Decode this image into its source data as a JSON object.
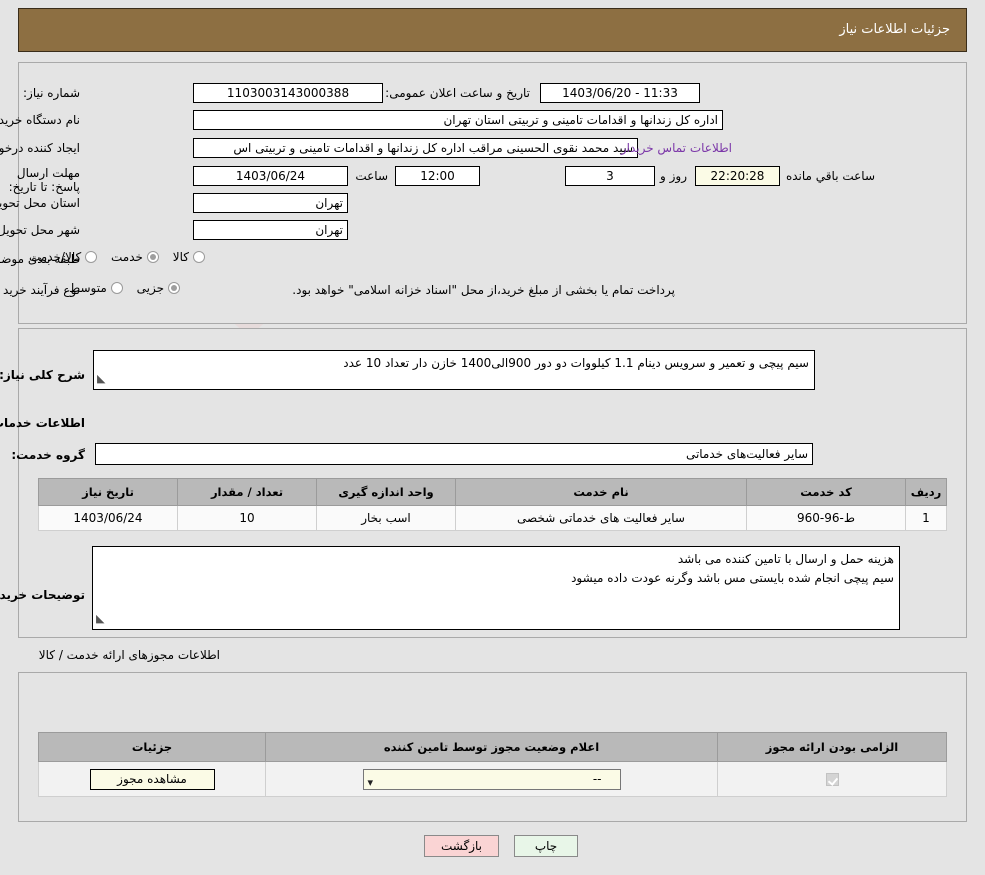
{
  "header": {
    "title": "جزئیات اطلاعات نیاز"
  },
  "watermark": {
    "text": "AnaTender.net"
  },
  "form": {
    "need_number": {
      "label": "شماره نیاز:",
      "value": "1103003143000388"
    },
    "announce_datetime": {
      "label": "تاریخ و ساعت اعلان عمومی:",
      "value": "11:33 - 1403/06/20"
    },
    "buyer_org": {
      "label": "نام دستگاه خریدار:",
      "value": "اداره کل زندانها و اقدامات تامینی و تربیتی استان تهران"
    },
    "requester": {
      "label": "ایجاد کننده درخواست:",
      "value": "سید محمد نقوی الحسینی مراقب  اداره کل زندانها و اقدامات تامینی و تربیتی اس",
      "contact_link": "اطلاعات تماس خریدار"
    },
    "deadline": {
      "label": "مهلت ارسال پاسخ: تا تاریخ:",
      "date": "1403/06/24",
      "hour_label": "ساعت",
      "hour": "12:00",
      "days": "3",
      "days_label": "روز و",
      "countdown": "22:20:28",
      "countdown_label": "ساعت باقي مانده"
    },
    "delivery_province": {
      "label": "استان محل تحویل:",
      "value": "تهران"
    },
    "delivery_city": {
      "label": "شهر محل تحویل:",
      "value": "تهران"
    },
    "subject_category": {
      "label": "طبقه بندی موضوعی:",
      "options": [
        {
          "label": "کالا",
          "selected": false
        },
        {
          "label": "خدمت",
          "selected": true
        },
        {
          "label": "کالا/خدمت",
          "selected": false
        }
      ]
    },
    "purchase_type": {
      "label": "نوع فرآیند خرید :",
      "options": [
        {
          "label": "جزیی",
          "selected": true
        },
        {
          "label": "متوسط",
          "selected": false
        }
      ],
      "note": "پرداخت تمام یا بخشی از مبلغ خرید،از محل \"اسناد خزانه اسلامی\" خواهد بود."
    }
  },
  "need_description": {
    "label": "شرح کلی نیاز:",
    "value": "سیم پیچی و تعمیر و سرویس دینام 1.1 کیلووات دو دور 900الی1400 خازن دار تعداد 10 عدد"
  },
  "services_section": {
    "title": "اطلاعات خدمات مورد نیاز",
    "service_group": {
      "label": "گروه خدمت:",
      "value": "سایر فعالیت‌های خدماتی"
    },
    "table": {
      "headers": [
        "ردیف",
        "کد خدمت",
        "نام خدمت",
        "واحد اندازه گیری",
        "تعداد / مقدار",
        "تاریخ نیاز"
      ],
      "rows": [
        {
          "row": "1",
          "code": "ط-96-960",
          "name": "سایر فعالیت های خدماتی شخصی",
          "unit": "اسب بخار",
          "qty": "10",
          "need_date": "1403/06/24"
        }
      ]
    }
  },
  "buyer_notes": {
    "label": "توضیحات خریدار:",
    "line1": "هزینه حمل و ارسال با تامین کننده می باشد",
    "line2": "سیم پیچی انجام شده بایستی مس باشد وگرنه عودت داده میشود"
  },
  "permits": {
    "section_title": "اطلاعات مجوزهای ارائه خدمت / کالا",
    "headers": [
      "الزامی بودن ارائه مجوز",
      "اعلام وضعیت مجوز توسط تامین کننده",
      "جزئیات"
    ],
    "rows": [
      {
        "required": true,
        "status_value": "--",
        "details_button": "مشاهده مجوز"
      }
    ]
  },
  "footer": {
    "print_label": "چاپ",
    "back_label": "بازگشت"
  }
}
